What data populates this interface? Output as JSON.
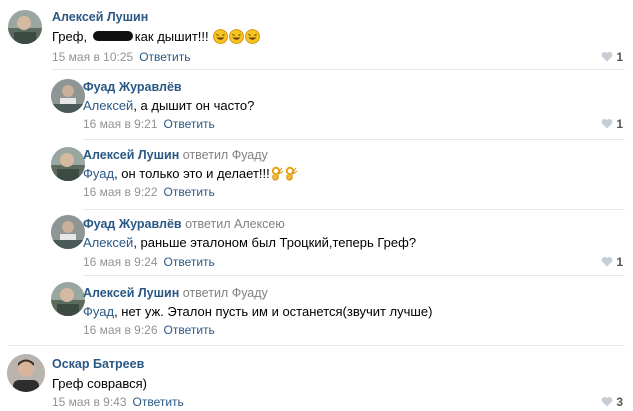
{
  "comments": [
    {
      "author": "Алексей Лушин",
      "replied": "",
      "text_pre": "Греф, ",
      "text_post": "как дышит!!!",
      "date": "15 мая в 10:25",
      "reply_label": "Ответить",
      "likes": "1"
    },
    {
      "author": "Фуад Журавлёв",
      "replied": "",
      "mention": "Алексей",
      "text": ", а дышит он часто?",
      "date": "16 мая в 9:21",
      "reply_label": "Ответить",
      "likes": "1"
    },
    {
      "author": "Алексей Лушин",
      "replied": "ответил Фуаду",
      "mention": "Фуад",
      "text": ", он только это и делает!!!",
      "date": "16 мая в 9:22",
      "reply_label": "Ответить",
      "likes": ""
    },
    {
      "author": "Фуад Журавлёв",
      "replied": "ответил Алексею",
      "mention": "Алексей",
      "text": ", раньше эталоном был Троцкий,теперь Греф?",
      "date": "16 мая в 9:24",
      "reply_label": "Ответить",
      "likes": "1"
    },
    {
      "author": "Алексей Лушин",
      "replied": "ответил Фуаду",
      "mention": "Фуад",
      "text": ", нет уж. Эталон пусть им и останется(звучит лучше)",
      "date": "16 мая в 9:26",
      "reply_label": "Ответить",
      "likes": ""
    },
    {
      "author": "Оскар Батреев",
      "replied": "",
      "text": "Греф соврався)",
      "date": "15 мая в 9:43",
      "reply_label": "Ответить",
      "likes": "3"
    }
  ],
  "colors": {
    "link": "#2a5885",
    "meta": "#939393",
    "divider": "#e7e8ec"
  },
  "icons": [
    "avatar",
    "heart-icon",
    "rofl-emoji",
    "ok-hand-emoji"
  ]
}
